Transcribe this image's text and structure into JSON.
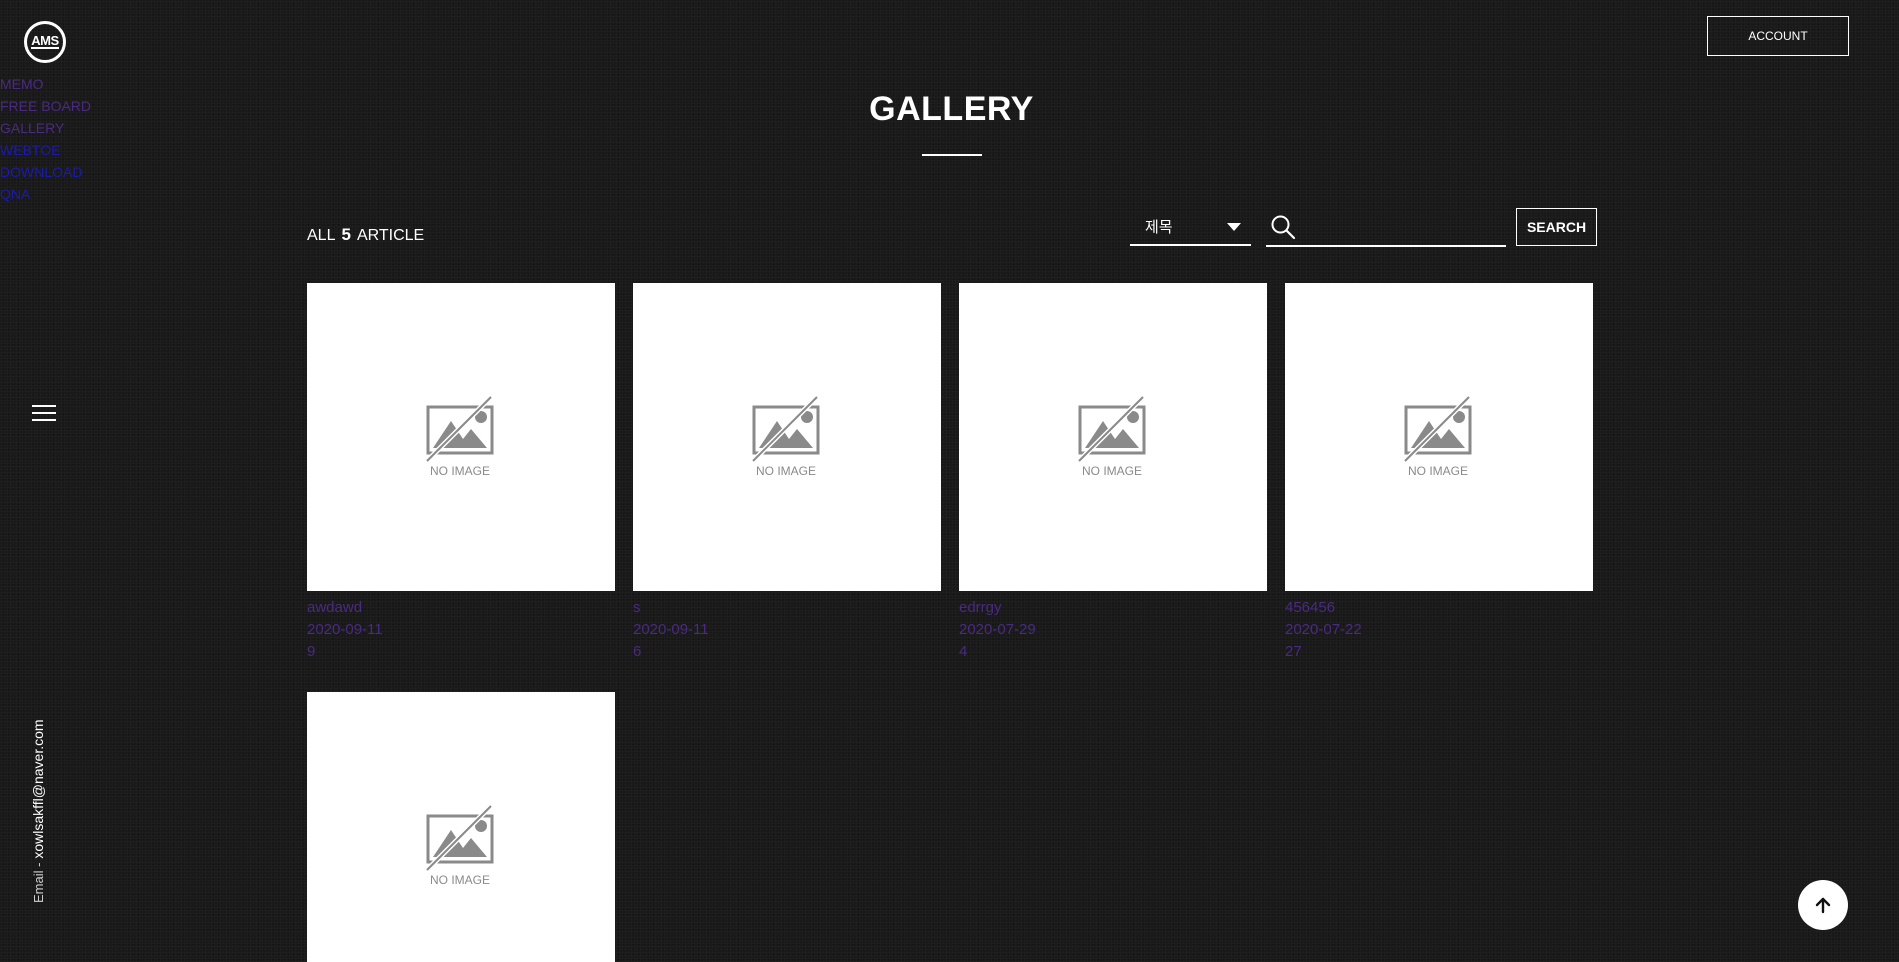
{
  "logo": {
    "text": "AMS"
  },
  "nav": {
    "items": [
      {
        "label": "MEMO",
        "state": "visited"
      },
      {
        "label": "FREE BOARD",
        "state": "visited"
      },
      {
        "label": "GALLERY",
        "state": "visited"
      },
      {
        "label": "WEBTOE",
        "state": "link"
      },
      {
        "label": "DOWNLOAD",
        "state": "link"
      },
      {
        "label": "QNA",
        "state": "link"
      }
    ]
  },
  "header": {
    "account_label": "ACCOUNT"
  },
  "page": {
    "title": "GALLERY"
  },
  "summary": {
    "all_label": "ALL",
    "count": "5",
    "article_label": "ARTICLE"
  },
  "search": {
    "select_value": "제목",
    "input_value": "",
    "button_label": "SEARCH"
  },
  "placeholder_text": "NO IMAGE",
  "gallery": [
    {
      "title": "awdawd",
      "date": "2020-09-11",
      "views": "9"
    },
    {
      "title": "s",
      "date": "2020-09-11",
      "views": "6"
    },
    {
      "title": "edrrgy",
      "date": "2020-07-29",
      "views": "4"
    },
    {
      "title": "456456",
      "date": "2020-07-22",
      "views": "27"
    },
    {
      "title": "",
      "date": "",
      "views": ""
    }
  ],
  "sidebar": {
    "email_label": "Email -",
    "email": "xowlsakffl@naver.com"
  },
  "colors": {
    "background": "#191919",
    "visited_link": "#4a2a82",
    "link": "#1a1ab0",
    "placeholder_gray": "#8a8a8a"
  },
  "icons": [
    "menu-icon",
    "search-icon",
    "chevron-down-icon",
    "no-image-icon",
    "arrow-up-icon"
  ]
}
